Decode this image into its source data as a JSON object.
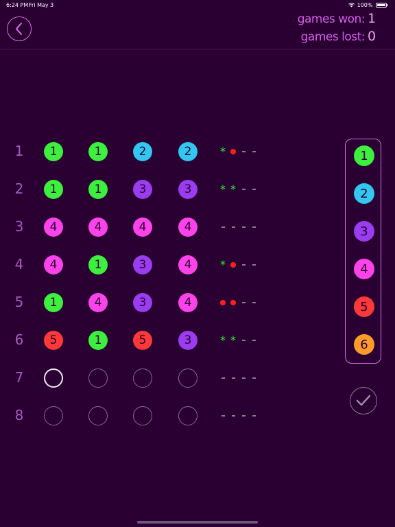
{
  "status_bar": {
    "time": "6:24 PM",
    "date": "Fri May 3",
    "battery": "100%"
  },
  "header": {
    "games_won_label": "games won:",
    "games_won_value": "1",
    "games_lost_label": "games lost:",
    "games_lost_value": "0"
  },
  "colors": {
    "1": "#3ef03e",
    "2": "#33c6ee",
    "3": "#9a3cf0",
    "4": "#ff43ea",
    "5": "#ff3838",
    "6": "#ff9b2d",
    "background": "#2a0033",
    "accent": "#d76fe8"
  },
  "board": {
    "rows": [
      {
        "label": "1",
        "pegs": [
          1,
          1,
          2,
          2
        ],
        "feedback": [
          "star",
          "dot",
          "dash",
          "dash"
        ]
      },
      {
        "label": "2",
        "pegs": [
          1,
          1,
          3,
          3
        ],
        "feedback": [
          "star",
          "star",
          "dash",
          "dash"
        ]
      },
      {
        "label": "3",
        "pegs": [
          4,
          4,
          4,
          4
        ],
        "feedback": [
          "dash",
          "dash",
          "dash",
          "dash"
        ]
      },
      {
        "label": "4",
        "pegs": [
          4,
          1,
          3,
          4
        ],
        "feedback": [
          "star",
          "dot",
          "dash",
          "dash"
        ]
      },
      {
        "label": "5",
        "pegs": [
          1,
          4,
          3,
          4
        ],
        "feedback": [
          "dot",
          "dot",
          "dash",
          "dash"
        ]
      },
      {
        "label": "6",
        "pegs": [
          5,
          1,
          5,
          3
        ],
        "feedback": [
          "star",
          "star",
          "dash",
          "dash"
        ]
      },
      {
        "label": "7",
        "pegs": [
          0,
          0,
          0,
          0
        ],
        "feedback": [
          "dash",
          "dash",
          "dash",
          "dash"
        ],
        "active": true
      },
      {
        "label": "8",
        "pegs": [
          0,
          0,
          0,
          0
        ],
        "feedback": [
          "dash",
          "dash",
          "dash",
          "dash"
        ]
      }
    ]
  },
  "palette": [
    "1",
    "2",
    "3",
    "4",
    "5",
    "6"
  ],
  "icons": {
    "back": "chevron-left-icon",
    "submit": "checkmark-icon"
  }
}
